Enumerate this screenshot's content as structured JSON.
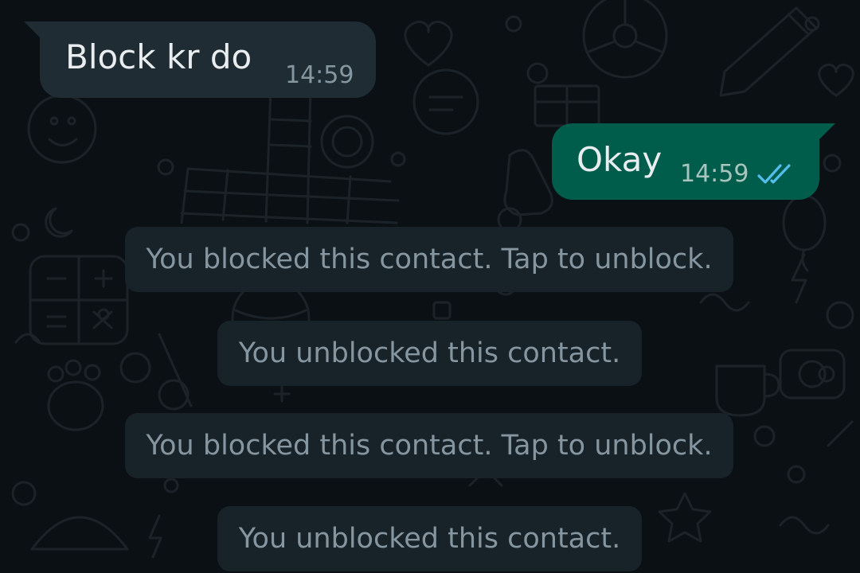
{
  "messages": [
    {
      "direction": "incoming",
      "text": "Block kr do",
      "time": "14:59"
    },
    {
      "direction": "outgoing",
      "text": "Okay",
      "time": "14:59",
      "status_icon": "double-check-read-icon"
    }
  ],
  "system_notices": [
    "You blocked this contact. Tap to unblock.",
    "You unblocked this contact.",
    "You blocked this contact. Tap to unblock.",
    "You unblocked this contact."
  ],
  "colors": {
    "background": "#0b1014",
    "incoming_bubble": "#1f2c33",
    "outgoing_bubble": "#005c4b",
    "notice_bg": "#182229",
    "text": "#e9edef",
    "secondary_text": "#8696a0",
    "read_tick": "#53bdeb"
  }
}
